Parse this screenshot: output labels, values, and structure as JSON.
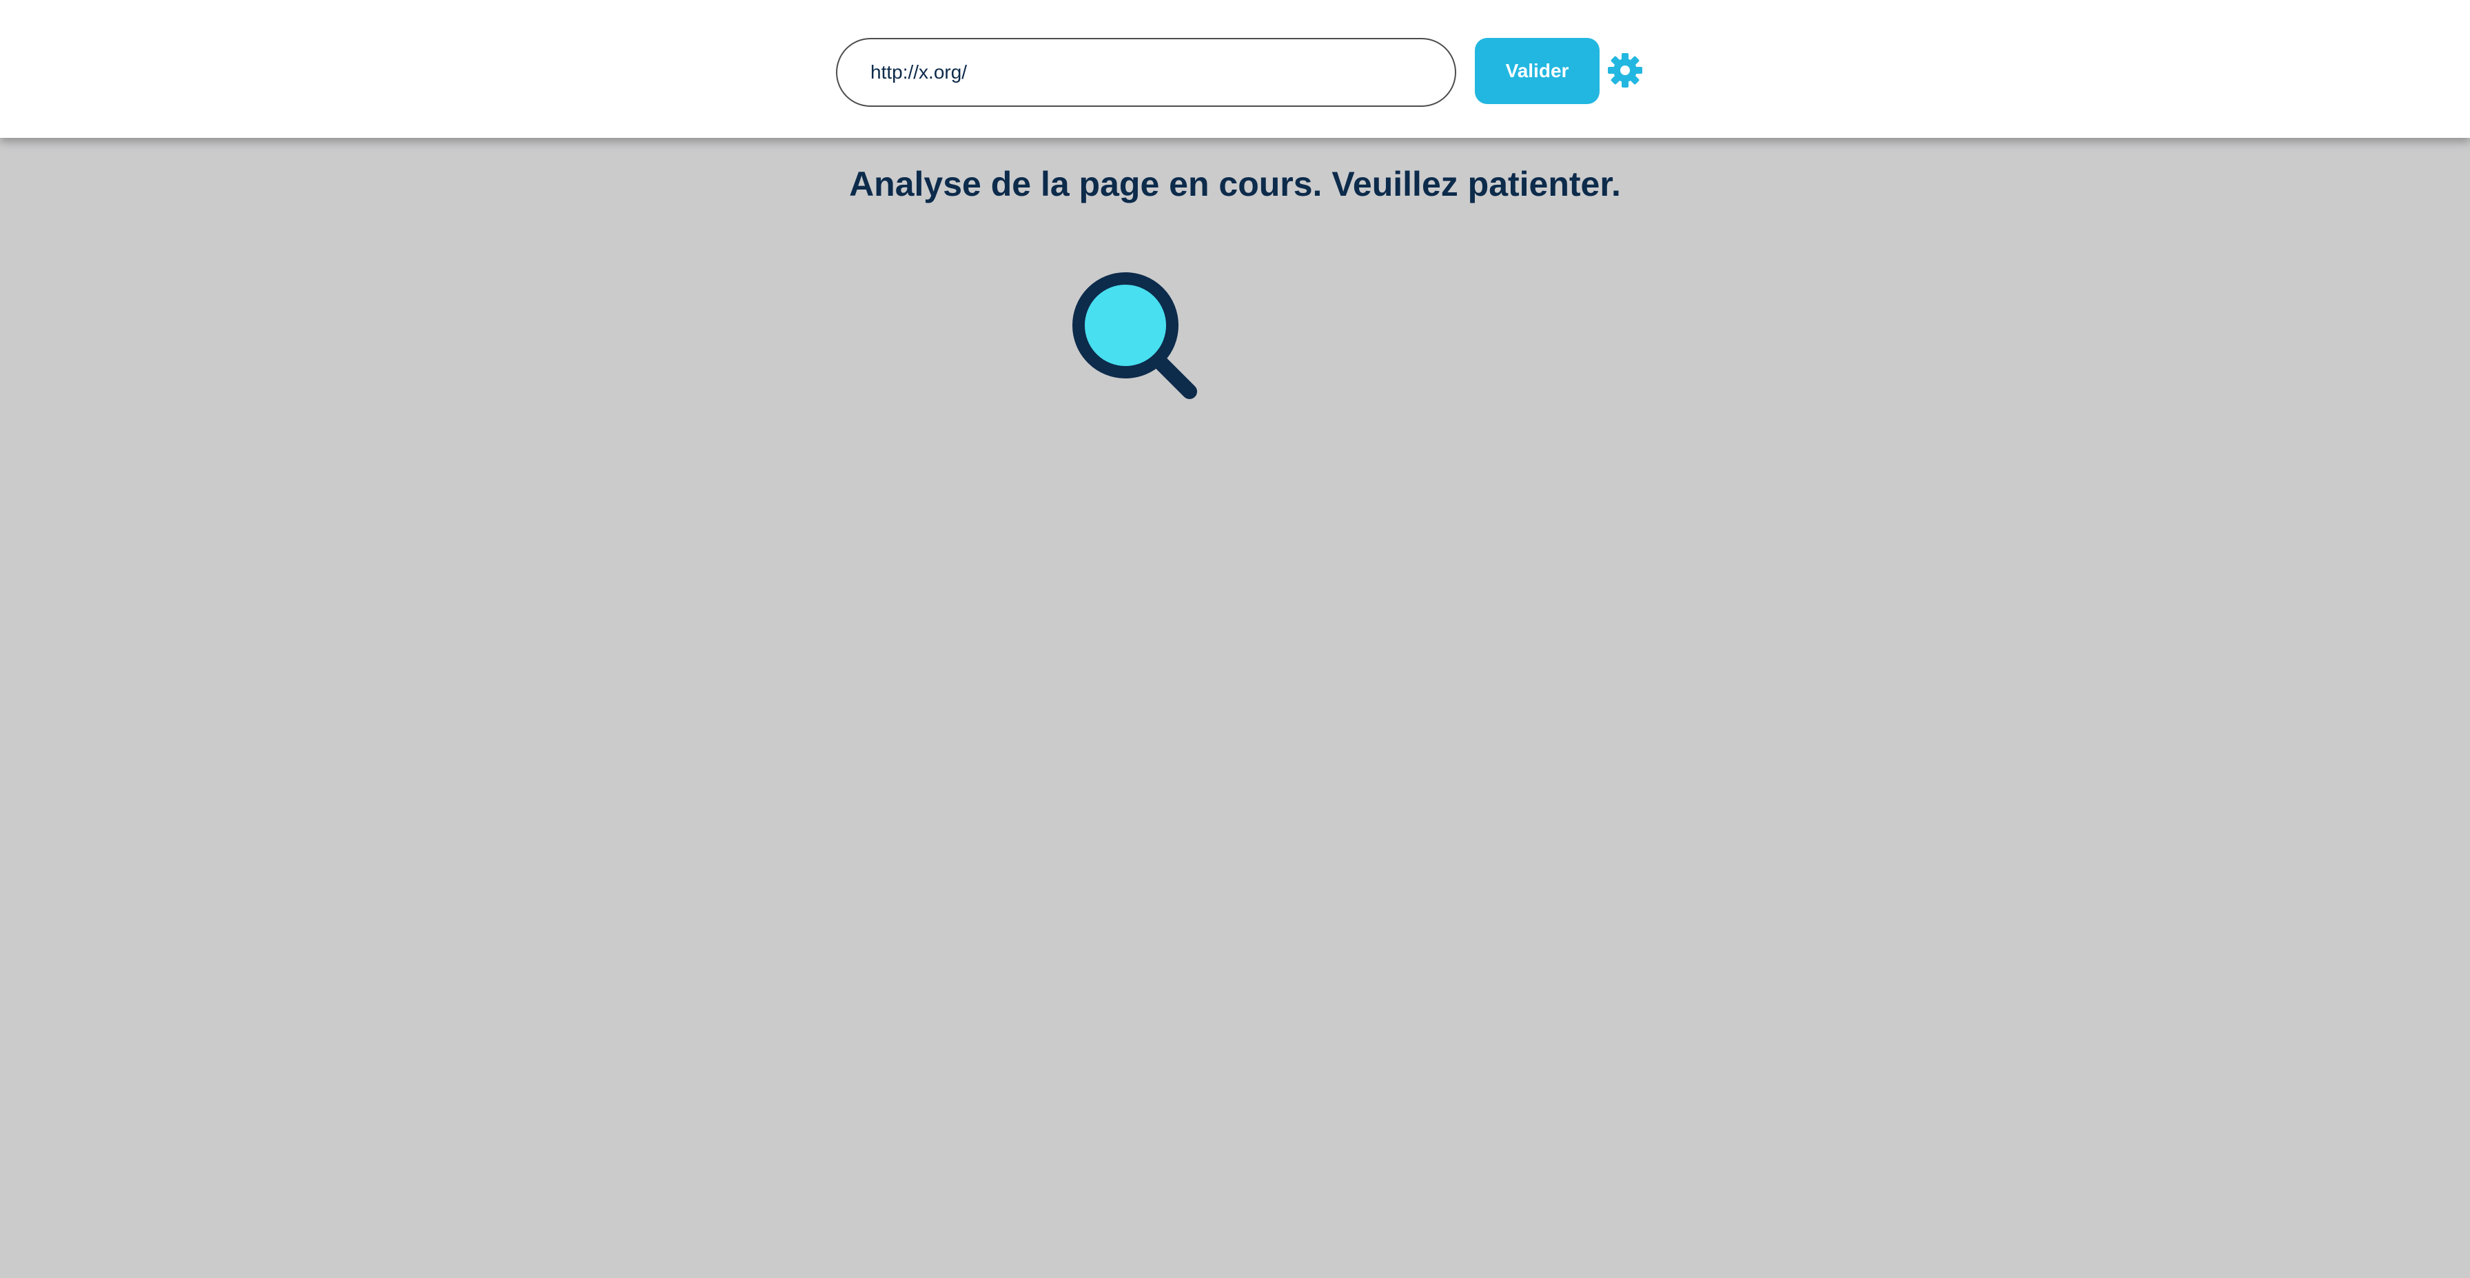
{
  "header": {
    "url_value": "http://x.org/",
    "validate_label": "Valider",
    "settings_icon": "gear-icon"
  },
  "main": {
    "status_text": "Analyse de la page en cours. Veuillez patienter.",
    "loader_icon": "magnifying-glass-icon"
  },
  "colors": {
    "accent": "#22b7e0",
    "text_dark": "#0d2b4b",
    "lens": "#48dff0",
    "background": "#cbcbcc"
  }
}
